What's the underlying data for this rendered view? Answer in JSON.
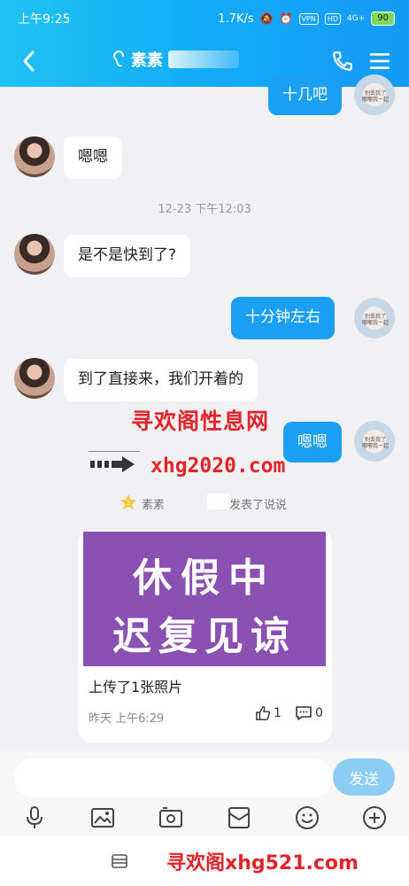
{
  "status": {
    "time": "上午9:25",
    "speed": "1.7K/s",
    "vpn": "VPN",
    "hd": "HD",
    "net": "4G+",
    "battery": "90"
  },
  "header": {
    "contact_name": "素素"
  },
  "messages": [
    {
      "from": "me",
      "text": "十几吧"
    },
    {
      "from": "her",
      "text": "嗯嗯"
    },
    {
      "from": "her",
      "text": "是不是快到了?"
    },
    {
      "from": "me",
      "text": "十分钟左右"
    },
    {
      "from": "her",
      "text": "到了直接来，我们开着的"
    },
    {
      "from": "me",
      "text": "嗯嗯"
    }
  ],
  "timestamp": "12-23 下午12:03",
  "watermark": {
    "title": "寻欢阁性息网",
    "link": "xhg2020.com",
    "bottom": "寻欢阁xhg521.com"
  },
  "notice": {
    "name": "素素",
    "action": "发表了说说"
  },
  "card": {
    "image_line1": "休假中",
    "image_line2": "迟复见谅",
    "caption": "上传了1张照片",
    "time": "昨天 上午6:29",
    "likes": "1",
    "comments": "0",
    "image_color": "#8a51b3"
  },
  "input": {
    "placeholder": "",
    "send_label": "发送"
  },
  "avatar_text": "别丢我了 嘟嘟我一起",
  "colors": {
    "accent": "#1a9ff5",
    "header_start": "#1ec3f3",
    "watermark": "#e0242a"
  }
}
